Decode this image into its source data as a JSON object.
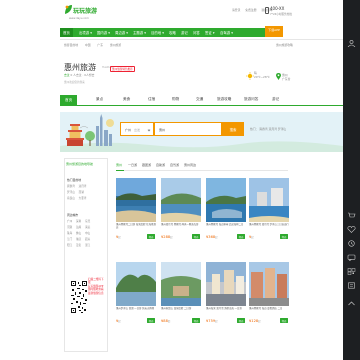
{
  "header": {
    "logo_text": "玩玩旅游",
    "logo_url": "www.dayu.com",
    "top_links": [
      "请登录",
      "免费注册",
      "我的订单"
    ],
    "hotline": "400-XX",
    "hotline_sub": "7*24小时服务热线",
    "app_label": "下载APP"
  },
  "nav": {
    "items": [
      "首页",
      "出境游 ▾",
      "国内游 ▾",
      "周边游 ▾",
      "主题游 ▾",
      "目的地 ▾",
      "攻略",
      "游记",
      "问答",
      "签证 ▾",
      "自驾游 ▾"
    ],
    "active_index": 0
  },
  "breadcrumb": {
    "items": [
      "旅游目的地",
      "中国",
      "广东",
      "惠州旅游"
    ],
    "right": "惠州旅游攻略"
  },
  "destination": {
    "title": "惠州旅游",
    "en": "Huizhou",
    "tag": "惠州旅游特色推荐",
    "meta_icon_label": "去过",
    "meta_count": "0",
    "meta_text": "人去过 · 0人想去",
    "subtitle": "惠州欢迎您的到来",
    "weather_label": "晴",
    "weather_temp": "20℃~28℃",
    "location_label": "惠州",
    "location_sub": "广东省"
  },
  "tabs": {
    "items": [
      "首页",
      "景点",
      "美食",
      "住宿",
      "购物",
      "交通",
      "旅游攻略",
      "旅游问答",
      "游记"
    ],
    "active_index": 0
  },
  "search": {
    "from_value": "广州",
    "from_placeholder": "出发",
    "keyword_value": "惠州",
    "button_label": "搜索",
    "hot_words": [
      "热门：",
      "巽寮湾",
      "双月湾",
      "罗浮山"
    ]
  },
  "sidebar": {
    "title": "惠州旅游目的地导航",
    "sections": [
      {
        "heading": "热门目的地",
        "rows": [
          [
            "巽寮湾",
            "双月湾"
          ],
          [
            "罗浮山",
            "西湖"
          ],
          [
            "南昆山",
            "大亚湾"
          ]
        ]
      },
      {
        "heading": "周边城市",
        "rows": [
          [
            "广州",
            "深圳",
            "东莞"
          ],
          [
            "河源",
            "汕尾",
            "清远"
          ],
          [
            "珠海",
            "佛山",
            "中山"
          ],
          [
            "江门",
            "肇庆",
            "韶关"
          ],
          [
            "阳江",
            "茂名",
            "湛江"
          ]
        ]
      }
    ],
    "qr_text": [
      "扫描二维码下载",
      "玩玩旅游APP",
      "随时随地查看",
      "最新旅游信息"
    ]
  },
  "products": {
    "tabs": [
      "惠州",
      "一日游",
      "跟团游",
      "自助游",
      "自驾游",
      "惠州周边"
    ],
    "active_index": 0,
    "cards": [
      {
        "title": "惠州巽寮湾二日游 海滨度假 住海景酒店",
        "price": "¥",
        "unit": "起",
        "badge": "特价"
      },
      {
        "title": "惠州双月湾 巽寮湾 两天一晚海岛游",
        "price": "¥288",
        "unit": "起",
        "badge": "特价"
      },
      {
        "title": "惠州巽寮湾 海边休闲 品尝海鲜二日",
        "price": "¥368",
        "unit": "起",
        "badge": "特价"
      },
      {
        "title": "惠州巽寮湾 双月湾 罗浮山三日自由行",
        "price": "¥",
        "unit": "起",
        "badge": "特价"
      },
      {
        "title": "惠州罗浮山 西湖 一日游 纯玩无购物",
        "price": "¥",
        "unit": "起",
        "badge": "特价"
      },
      {
        "title": "惠州南昆山 温泉度假 二日游",
        "price": "¥88",
        "unit": "起",
        "badge": "特价"
      },
      {
        "title": "惠州海滨 双月湾 游艇出海 一日游",
        "price": "¥759",
        "unit": "起",
        "badge": "特价"
      },
      {
        "title": "惠州巽寮湾 海边 度假酒店 二日",
        "price": "¥128",
        "unit": "起",
        "badge": "特价"
      }
    ]
  },
  "colors": {
    "brand_green": "#2eaa2e",
    "accent_orange": "#f39700",
    "price_red": "#e60"
  }
}
